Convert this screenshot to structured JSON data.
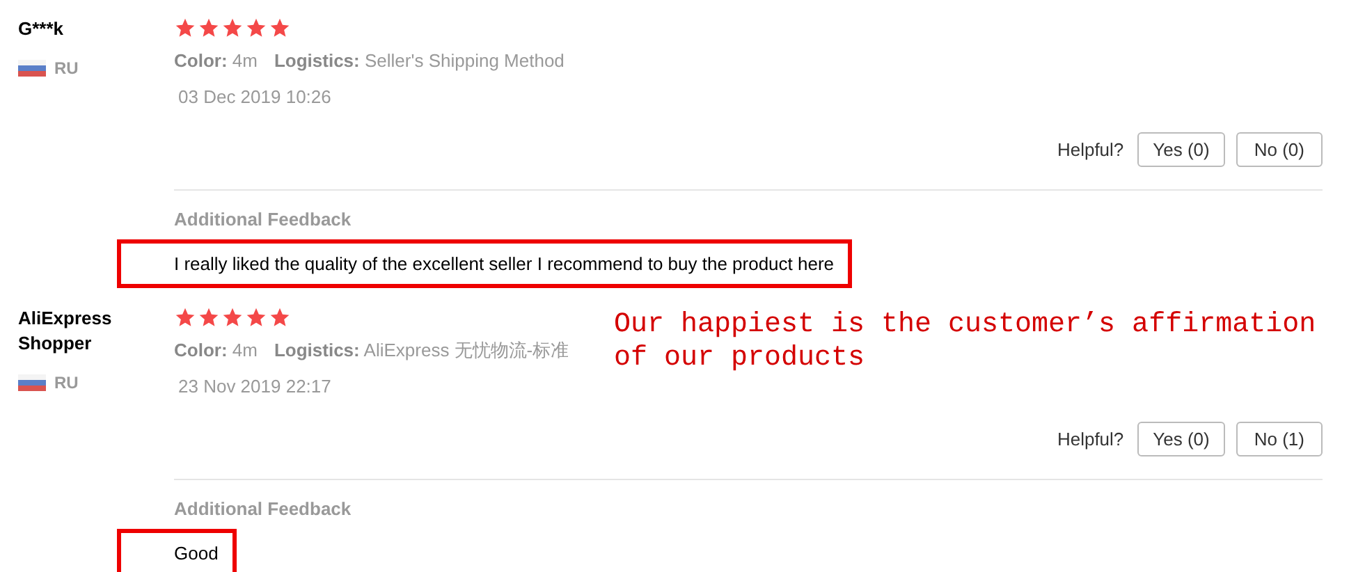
{
  "reviews": [
    {
      "reviewer": "G***k",
      "country": "RU",
      "stars": 5,
      "color_label": "Color:",
      "color_value": "4m",
      "logistics_label": "Logistics:",
      "logistics_value": "Seller's Shipping Method",
      "date": "03 Dec 2019 10:26",
      "helpful_label": "Helpful?",
      "yes_button": "Yes (0)",
      "no_button": "No (0)",
      "feedback_label": "Additional Feedback",
      "feedback": "I really liked the quality of the excellent seller I recommend to buy the product here",
      "highlighted": true
    },
    {
      "reviewer": "AliExpress Shopper",
      "country": "RU",
      "stars": 5,
      "color_label": "Color:",
      "color_value": "4m",
      "logistics_label": "Logistics:",
      "logistics_value": "AliExpress 无忧物流-标准",
      "date": "23 Nov 2019 22:17",
      "helpful_label": "Helpful?",
      "yes_button": "Yes (0)",
      "no_button": "No (1)",
      "feedback_label": "Additional Feedback",
      "feedback": "Good",
      "highlighted": true,
      "caption": "Our happiest is the customer’s affirmation of our products"
    }
  ]
}
